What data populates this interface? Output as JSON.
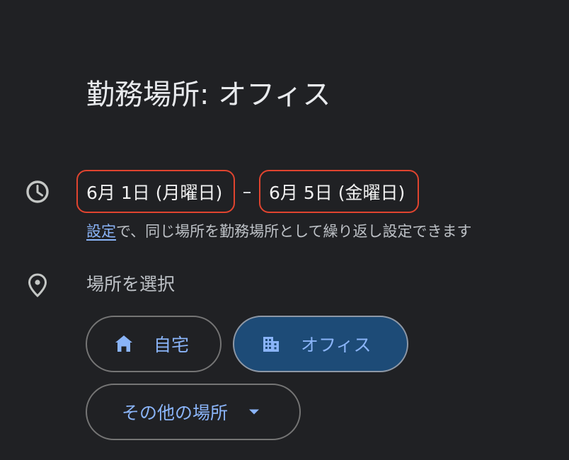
{
  "title": "勤務場所: オフィス",
  "date_range": {
    "start": "6月 1日 (月曜日)",
    "separator": "–",
    "end": "6月 5日 (金曜日)"
  },
  "repeat": {
    "link_text": "設定",
    "note": "で、同じ場所を勤務場所として繰り返し設定できます"
  },
  "location": {
    "label": "場所を選択",
    "options": {
      "home": "自宅",
      "office": "オフィス",
      "other": "その他の場所"
    },
    "selected": "office"
  },
  "colors": {
    "background": "#202124",
    "accent": "#8ab4f8",
    "highlight_outline": "#e0442f",
    "selected_chip": "#1d4b77"
  },
  "icons": {
    "time": "clock-icon",
    "location": "location-pin-icon",
    "home": "home-icon",
    "office": "building-icon",
    "dropdown": "caret-down-icon"
  }
}
